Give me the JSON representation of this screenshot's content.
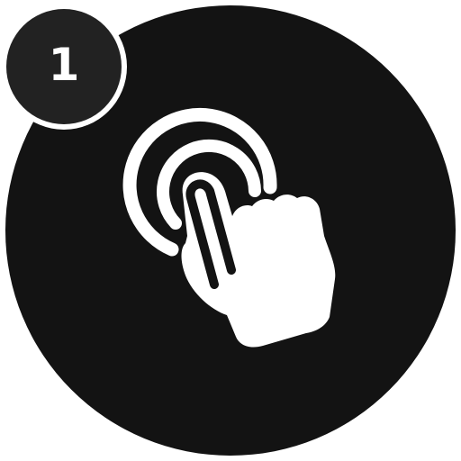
{
  "badge": {
    "number": "1"
  },
  "icon": {
    "name": "tap-gesture-icon"
  },
  "colors": {
    "circle": "#131313",
    "badge": "#222222",
    "foreground": "#ffffff",
    "background": "#ffffff"
  }
}
